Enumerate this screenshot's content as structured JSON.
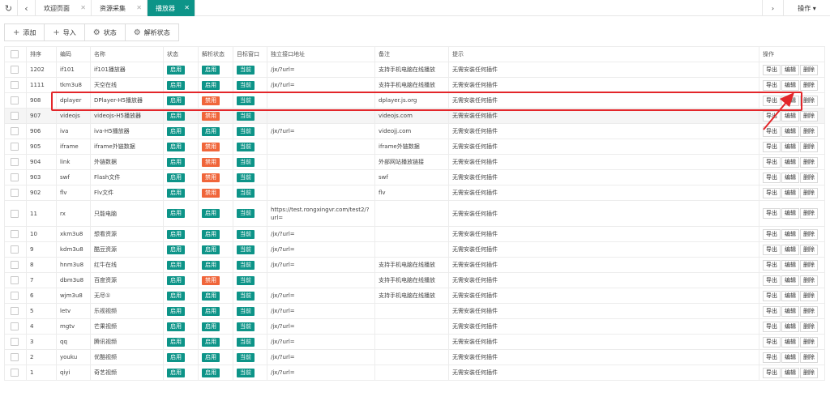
{
  "tabs": [
    {
      "label": "欢迎页面",
      "active": false
    },
    {
      "label": "资源采集",
      "active": false
    },
    {
      "label": "播放器",
      "active": true
    }
  ],
  "top_right": {
    "op_label": "操作 ▾"
  },
  "toolbar": {
    "add": "添加",
    "import": "导入",
    "status": "状态",
    "parse_status": "解析状态"
  },
  "columns": [
    "排序",
    "编码",
    "名称",
    "状态",
    "解析状态",
    "目标窗口",
    "独立接口地址",
    "备注",
    "提示",
    "操作"
  ],
  "actions": {
    "export": "导出",
    "edit": "编辑",
    "delete": "删除"
  },
  "rows": [
    {
      "sort": "1202",
      "code": "if101",
      "name": "if101播放器",
      "status": "启用",
      "parse": "启用",
      "target": "当前",
      "url": "/jx/?url=",
      "note": "支持手机电脑在线播放",
      "tip": "无需安装任何插件"
    },
    {
      "sort": "1111",
      "code": "tkm3u8",
      "name": "天空在线",
      "status": "启用",
      "parse": "启用",
      "target": "当前",
      "url": "/jx/?url=",
      "note": "支持手机电脑在线播放",
      "tip": "无需安装任何插件"
    },
    {
      "sort": "908",
      "code": "dplayer",
      "name": "DPlayer-H5播放器",
      "status": "启用",
      "parse": "禁用",
      "target": "当前",
      "url": "",
      "note": "dplayer.js.org",
      "tip": "无需安装任何插件"
    },
    {
      "sort": "907",
      "code": "videojs",
      "name": "videojs-H5播放器",
      "status": "启用",
      "parse": "禁用",
      "target": "当前",
      "url": "",
      "note": "videojs.com",
      "tip": "无需安装任何插件"
    },
    {
      "sort": "906",
      "code": "iva",
      "name": "iva-H5播放器",
      "status": "启用",
      "parse": "启用",
      "target": "当前",
      "url": "/jx/?url=",
      "note": "videojj.com",
      "tip": "无需安装任何插件"
    },
    {
      "sort": "905",
      "code": "iframe",
      "name": "iframe外链数据",
      "status": "启用",
      "parse": "禁用",
      "target": "当前",
      "url": "",
      "note": "iframe外链数据",
      "tip": "无需安装任何插件"
    },
    {
      "sort": "904",
      "code": "link",
      "name": "外链数据",
      "status": "启用",
      "parse": "禁用",
      "target": "当前",
      "url": "",
      "note": "外部网站播放链接",
      "tip": "无需安装任何插件"
    },
    {
      "sort": "903",
      "code": "swf",
      "name": "Flash文件",
      "status": "启用",
      "parse": "禁用",
      "target": "当前",
      "url": "",
      "note": "swf",
      "tip": "无需安装任何插件"
    },
    {
      "sort": "902",
      "code": "flv",
      "name": "Flv文件",
      "status": "启用",
      "parse": "禁用",
      "target": "当前",
      "url": "",
      "note": "flv",
      "tip": "无需安装任何插件"
    },
    {
      "sort": "11",
      "code": "rx",
      "name": "只能电脑",
      "status": "启用",
      "parse": "启用",
      "target": "当前",
      "url": "https://test.rongxingvr.com/test2/?url=",
      "note": "",
      "tip": "无需安装任何插件",
      "tall": true
    },
    {
      "sort": "10",
      "code": "xkm3u8",
      "name": "想看资源",
      "status": "启用",
      "parse": "启用",
      "target": "当前",
      "url": "/jx/?url=",
      "note": "",
      "tip": "无需安装任何插件"
    },
    {
      "sort": "9",
      "code": "kdm3u8",
      "name": "酷豆资源",
      "status": "启用",
      "parse": "启用",
      "target": "当前",
      "url": "/jx/?url=",
      "note": "",
      "tip": "无需安装任何插件"
    },
    {
      "sort": "8",
      "code": "hnm3u8",
      "name": "红牛在线",
      "status": "启用",
      "parse": "启用",
      "target": "当前",
      "url": "/jx/?url=",
      "note": "支持手机电脑在线播放",
      "tip": "无需安装任何插件"
    },
    {
      "sort": "7",
      "code": "dbm3u8",
      "name": "百度资源",
      "status": "启用",
      "parse": "禁用",
      "target": "当前",
      "url": "",
      "note": "支持手机电脑在线播放",
      "tip": "无需安装任何插件"
    },
    {
      "sort": "6",
      "code": "wjm3u8",
      "name": "无尽①",
      "status": "启用",
      "parse": "启用",
      "target": "当前",
      "url": "/jx/?url=",
      "note": "支持手机电脑在线播放",
      "tip": "无需安装任何插件"
    },
    {
      "sort": "5",
      "code": "letv",
      "name": "乐视视频",
      "status": "启用",
      "parse": "启用",
      "target": "当前",
      "url": "/jx/?url=",
      "note": "",
      "tip": "无需安装任何插件"
    },
    {
      "sort": "4",
      "code": "mgtv",
      "name": "芒果视频",
      "status": "启用",
      "parse": "启用",
      "target": "当前",
      "url": "/jx/?url=",
      "note": "",
      "tip": "无需安装任何插件"
    },
    {
      "sort": "3",
      "code": "qq",
      "name": "腾讯视频",
      "status": "启用",
      "parse": "启用",
      "target": "当前",
      "url": "/jx/?url=",
      "note": "",
      "tip": "无需安装任何插件"
    },
    {
      "sort": "2",
      "code": "youku",
      "name": "优酷视频",
      "status": "启用",
      "parse": "启用",
      "target": "当前",
      "url": "/jx/?url=",
      "note": "",
      "tip": "无需安装任何插件"
    },
    {
      "sort": "1",
      "code": "qiyi",
      "name": "奇艺视频",
      "status": "启用",
      "parse": "启用",
      "target": "当前",
      "url": "/jx/?url=",
      "note": "",
      "tip": "无需安装任何插件"
    }
  ],
  "colors": {
    "accent": "#0d9488",
    "disabled": "#f0653a",
    "annotation": "#e3262a"
  },
  "icons": {
    "refresh": "refresh-icon",
    "back": "chevron-left-icon",
    "forward": "chevron-right-icon",
    "add": "plus-icon",
    "import": "plus-icon",
    "status": "gear-icon",
    "parse_status": "gear-icon"
  }
}
